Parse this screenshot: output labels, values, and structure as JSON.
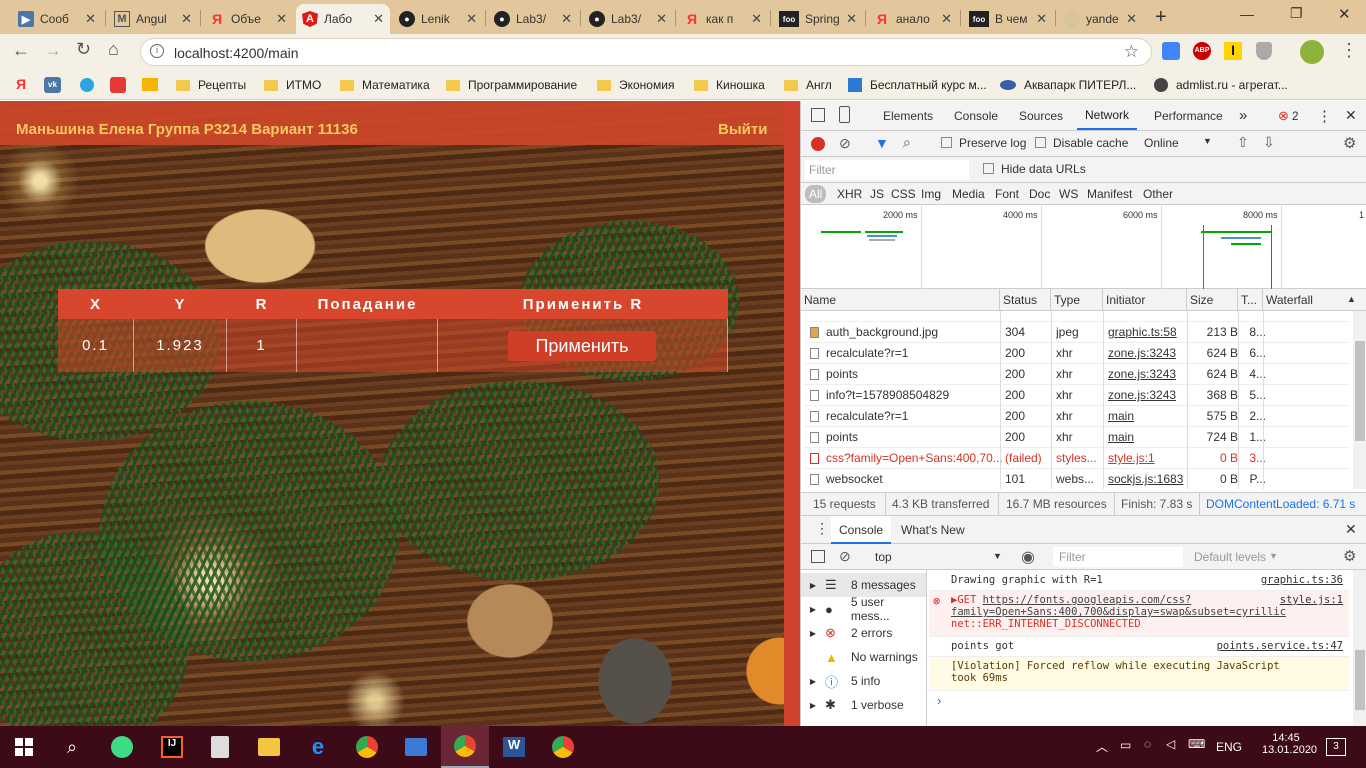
{
  "browser": {
    "tabs": [
      {
        "label": "Сооб",
        "icon": "vk-icon"
      },
      {
        "label": "Angul",
        "icon": "m-icon"
      },
      {
        "label": "Объе",
        "icon": "yandex-icon"
      },
      {
        "label": "Лабо",
        "icon": "angular-icon"
      },
      {
        "label": "Lenik",
        "icon": "github-icon"
      },
      {
        "label": "Lab3/",
        "icon": "gitlab-icon"
      },
      {
        "label": "Lab3/",
        "icon": "github-icon"
      },
      {
        "label": "как п",
        "icon": "yandex-icon"
      },
      {
        "label": "Spring",
        "icon": "foo-icon"
      },
      {
        "label": "анало",
        "icon": "yandex-icon"
      },
      {
        "label": "В чем",
        "icon": "foo-icon"
      },
      {
        "label": "yande",
        "icon": "blank-icon"
      }
    ],
    "url": "localhost:4200/main",
    "bookmarks": [
      "Рецепты",
      "ИТМО",
      "Математика",
      "Программирование",
      "Экономия",
      "Киношка",
      "Англ",
      "Бесплатный курс м...",
      "Аквапарк ПИТЕРЛ...",
      "admlist.ru - агрегат..."
    ],
    "colors": {
      "tabstrip": "#e1c79b",
      "toolbar": "#f5f0e6",
      "accent": "#d8462d",
      "gold": "#f4c95d"
    }
  },
  "page": {
    "header_title": "Маньшина Елена Группа P3214 Вариант 11136",
    "logout": "Выйти",
    "table": {
      "headers": [
        "X",
        "Y",
        "R",
        "Попадание",
        "Применить R"
      ],
      "row": {
        "x": "0.1",
        "y": "1.923",
        "r": "1",
        "hit": "",
        "apply_label": "Применить"
      }
    }
  },
  "devtools": {
    "tabs": [
      "Elements",
      "Console",
      "Sources",
      "Network",
      "Performance"
    ],
    "error_count": "2",
    "network": {
      "preserve_log": "Preserve log",
      "disable_cache": "Disable cache",
      "throttle": "Online",
      "filter_placeholder": "Filter",
      "hide_data_urls": "Hide data URLs",
      "types": [
        "All",
        "XHR",
        "JS",
        "CSS",
        "Img",
        "Media",
        "Font",
        "Doc",
        "WS",
        "Manifest",
        "Other"
      ],
      "timeline_ticks": [
        "2000 ms",
        "4000 ms",
        "6000 ms",
        "8000 ms",
        "1"
      ],
      "columns": [
        "Name",
        "Status",
        "Type",
        "Initiator",
        "Size",
        "T...",
        "Waterfall"
      ],
      "rows": [
        {
          "name": "auth_background.jpg",
          "status": "304",
          "type": "jpeg",
          "initiator": "graphic.ts:58",
          "size": "213 B",
          "time": "8..."
        },
        {
          "name": "recalculate?r=1",
          "status": "200",
          "type": "xhr",
          "initiator": "zone.js:3243",
          "size": "624 B",
          "time": "6..."
        },
        {
          "name": "points",
          "status": "200",
          "type": "xhr",
          "initiator": "zone.js:3243",
          "size": "624 B",
          "time": "4..."
        },
        {
          "name": "info?t=1578908504829",
          "status": "200",
          "type": "xhr",
          "initiator": "zone.js:3243",
          "size": "368 B",
          "time": "5..."
        },
        {
          "name": "recalculate?r=1",
          "status": "200",
          "type": "xhr",
          "initiator": "main",
          "size": "575 B",
          "time": "2..."
        },
        {
          "name": "points",
          "status": "200",
          "type": "xhr",
          "initiator": "main",
          "size": "724 B",
          "time": "1..."
        },
        {
          "name": "css?family=Open+Sans:400,70...",
          "status": "(failed)",
          "type": "styles...",
          "initiator": "style.js:1",
          "size": "0 B",
          "time": "3..."
        },
        {
          "name": "websocket",
          "status": "101",
          "type": "webs...",
          "initiator": "sockjs.js:1683",
          "size": "0 B",
          "time": "P..."
        }
      ],
      "summary": {
        "requests": "15 requests",
        "transferred": "4.3 KB transferred",
        "resources": "16.7 MB resources",
        "finish": "Finish: 7.83 s",
        "domcontentloaded": "DOMContentLoaded: 6.71 s"
      }
    },
    "drawer": {
      "tabs": [
        "Console",
        "What's New"
      ],
      "context": "top",
      "filter_placeholder": "Filter",
      "levels": "Default levels",
      "sidebar": [
        {
          "label": "8 messages",
          "icon": "list-icon"
        },
        {
          "label": "5 user mess...",
          "icon": "user-icon"
        },
        {
          "label": "2 errors",
          "icon": "error-icon"
        },
        {
          "label": "No warnings",
          "icon": "warning-icon"
        },
        {
          "label": "5 info",
          "icon": "info-icon"
        },
        {
          "label": "1 verbose",
          "icon": "bug-icon"
        }
      ],
      "messages": [
        {
          "text": "Drawing graphic with R=1",
          "source": "graphic.ts:36",
          "level": "log"
        },
        {
          "text_prefix": "▶GET ",
          "link": "https://fonts.googleapis.com/css?family=Open+Sans:400,700&display=swap&subset=cyrillic",
          "text_suffix": " net::ERR_INTERNET_DISCONNECTED",
          "source": "style.js:1",
          "level": "error"
        },
        {
          "text": "points got",
          "source": "points.service.ts:47",
          "level": "log"
        },
        {
          "text": "[Violation] Forced reflow while executing JavaScript took 69ms",
          "source": "",
          "level": "violation"
        }
      ]
    }
  },
  "taskbar": {
    "time": "14:45",
    "date": "13.01.2020",
    "lang": "ENG",
    "notifications": "3"
  }
}
